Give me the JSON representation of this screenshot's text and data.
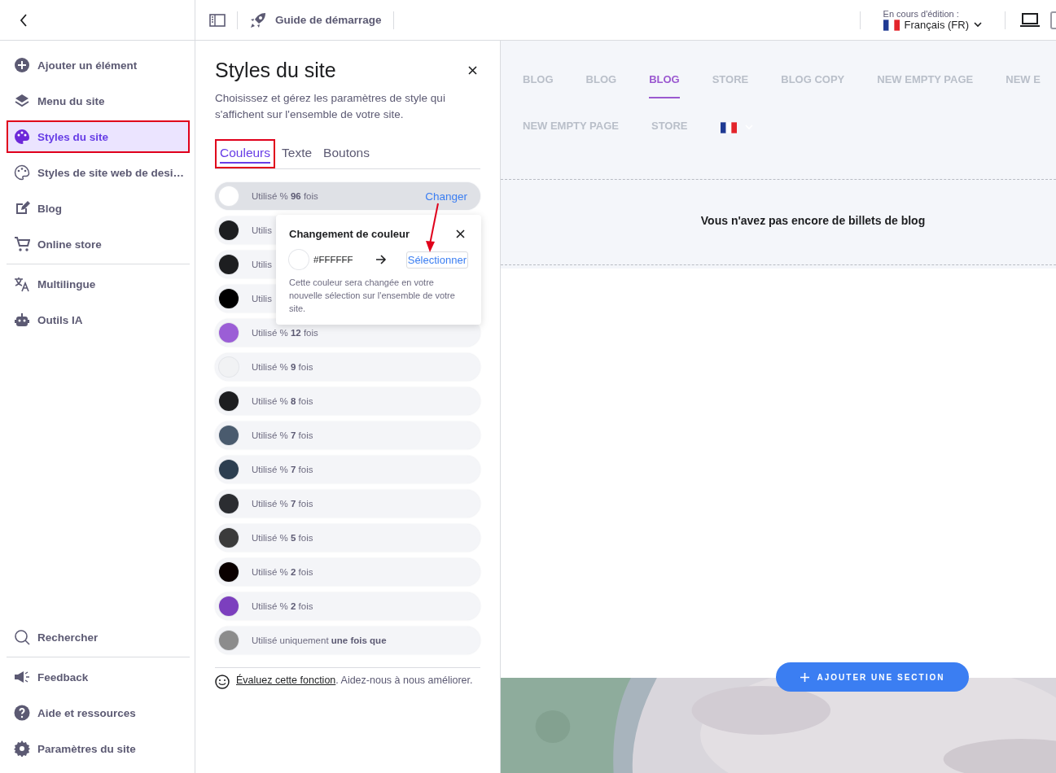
{
  "topbar": {
    "guide": "Guide de démarrage",
    "editing_label": "En cours d'édition :",
    "language": "Français (FR)",
    "devices": [
      {
        "kind": "desktop",
        "selected": true
      },
      {
        "kind": "mobile",
        "selected": false
      }
    ]
  },
  "sidebar": {
    "items": [
      {
        "kind": "plus",
        "label": "Ajouter un élément",
        "selected": false,
        "annotated": false
      },
      {
        "kind": "layers",
        "label": "Menu du site",
        "selected": false,
        "annotated": false
      },
      {
        "kind": "palette",
        "label": "Styles du site",
        "selected": true,
        "annotated": true
      },
      {
        "kind": "palette-outline",
        "label": "Styles de site web de desi…",
        "selected": false,
        "annotated": false
      },
      {
        "kind": "edit",
        "label": "Blog",
        "selected": false,
        "annotated": false
      },
      {
        "kind": "cart",
        "label": "Online store",
        "selected": false,
        "annotated": false,
        "divider_after": true
      },
      {
        "kind": "translate",
        "label": "Multilingue",
        "selected": false,
        "annotated": false
      },
      {
        "kind": "robot",
        "label": "Outils IA",
        "selected": false,
        "annotated": false
      }
    ],
    "bottom_items": [
      {
        "kind": "search",
        "label": "Rechercher",
        "divider_after": true
      },
      {
        "kind": "megaphone",
        "label": "Feedback"
      },
      {
        "kind": "help",
        "label": "Aide et ressources"
      },
      {
        "kind": "gear",
        "label": "Paramètres du site"
      }
    ]
  },
  "panel": {
    "title": "Styles du site",
    "description": "Choisissez et gérez les paramètres de style qui s'affichent sur l'ensemble de votre site.",
    "tabs": [
      {
        "label": "Couleurs",
        "selected": true,
        "annotated": true
      },
      {
        "label": "Texte",
        "selected": false,
        "annotated": false
      },
      {
        "label": "Boutons",
        "selected": false,
        "annotated": false
      }
    ],
    "colors": [
      {
        "color": "#ffffff",
        "usage": "Utilisé % **96** fois",
        "selected": true,
        "action": "Changer"
      },
      {
        "color": "#1d1e20",
        "usage": "Utilis",
        "selected": false
      },
      {
        "color": "#1d1e20",
        "usage": "Utilis",
        "selected": false
      },
      {
        "color": "#000000",
        "usage": "Utilis",
        "selected": false
      },
      {
        "color": "#9b5ed6",
        "usage": "Utilisé % **12** fois",
        "selected": false
      },
      {
        "color": "#f1f2f4",
        "usage": "Utilisé % **9** fois",
        "selected": false
      },
      {
        "color": "#1d1e20",
        "usage": "Utilisé % **8** fois",
        "selected": false
      },
      {
        "color": "#4a5b6e",
        "usage": "Utilisé % **7** fois",
        "selected": false
      },
      {
        "color": "#2c3e50",
        "usage": "Utilisé % **7** fois",
        "selected": false
      },
      {
        "color": "#2b2d31",
        "usage": "Utilisé % **7** fois",
        "selected": false
      },
      {
        "color": "#3b3b3b",
        "usage": "Utilisé % **5** fois",
        "selected": false
      },
      {
        "color": "#0a0000",
        "usage": "Utilisé % **2** fois",
        "selected": false
      },
      {
        "color": "#7c3fbe",
        "usage": "Utilisé % **2** fois",
        "selected": false
      },
      {
        "color": "#8c8c8c",
        "usage": "Utilisé uniquement **une fois que**",
        "selected": false
      }
    ],
    "feedback_link": "Évaluez cette fonction",
    "feedback_text": ". Aidez-nous à nous améliorer.",
    "popover": {
      "title": "Changement de couleur",
      "from_hex": "#FFFFFF",
      "action": "Sélectionner",
      "note": "Cette couleur sera changée en votre nouvelle sélection sur l'ensemble de votre site."
    }
  },
  "preview": {
    "nav": [
      {
        "label": "BLOG",
        "selected": false
      },
      {
        "label": "BLOG",
        "selected": false
      },
      {
        "label": "BLOG",
        "selected": true
      },
      {
        "label": "STORE",
        "selected": false
      },
      {
        "label": "BLOG COPY",
        "selected": false
      },
      {
        "label": "NEW EMPTY PAGE",
        "selected": false
      },
      {
        "label": "NEW E",
        "selected": false
      },
      {
        "label": "NEW EMPTY PAGE",
        "selected": false
      },
      {
        "label": "STORE",
        "selected": false
      }
    ],
    "empty_message": "Vous n'avez pas encore de billets de blog",
    "add_section": "AJOUTER UNE SECTION"
  }
}
